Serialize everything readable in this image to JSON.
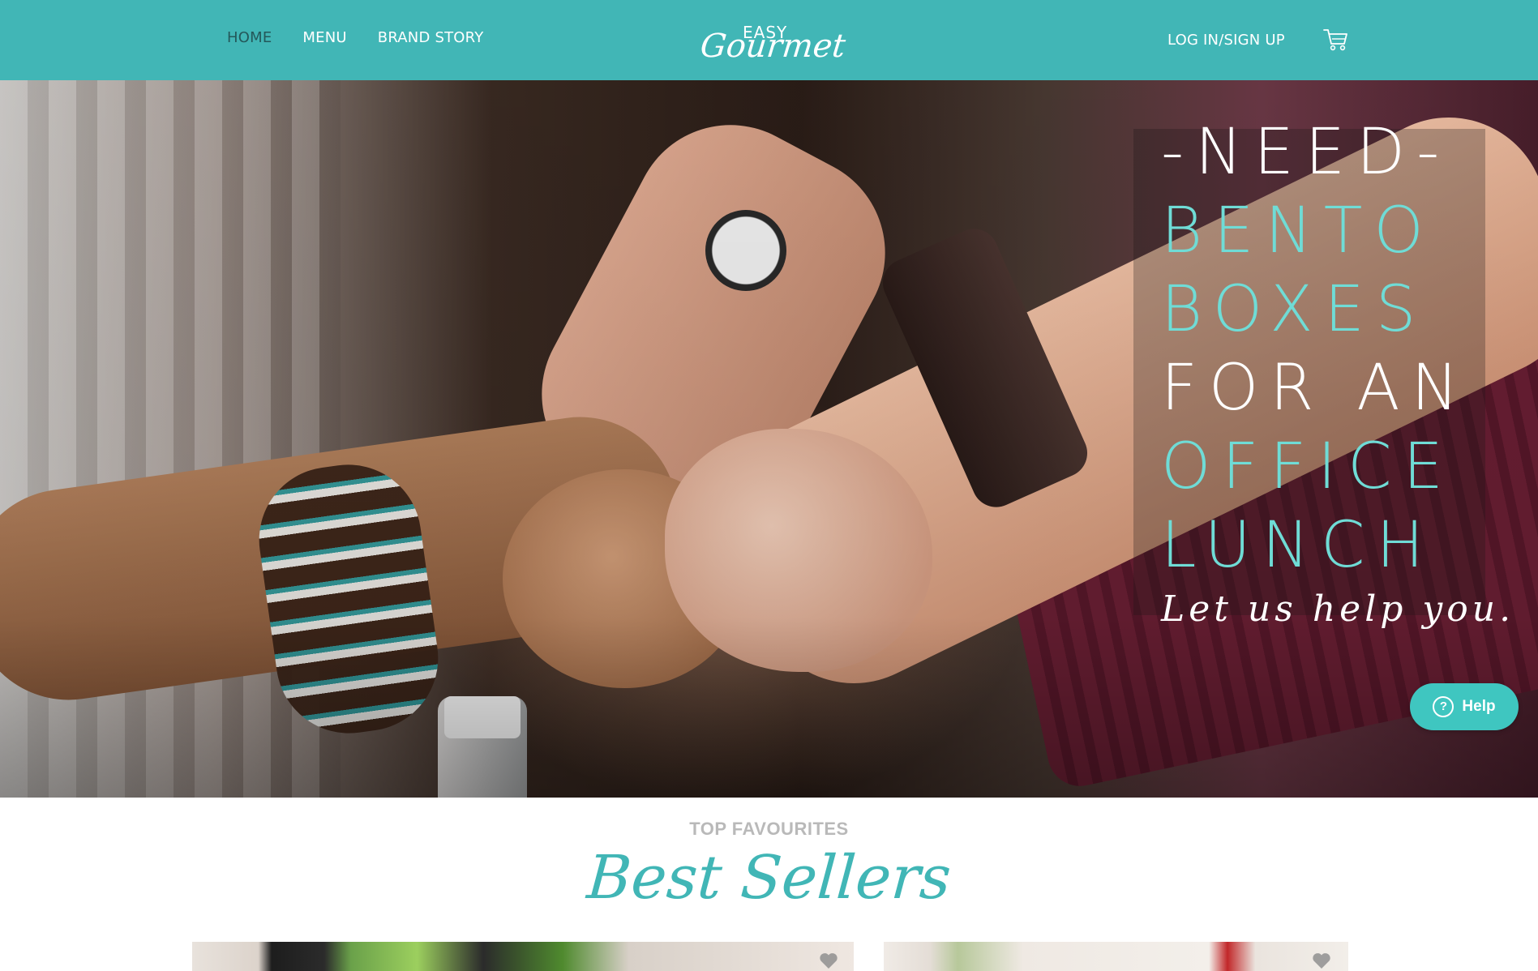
{
  "header": {
    "nav": [
      {
        "label": "HOME",
        "active": true
      },
      {
        "label": "MENU",
        "active": false
      },
      {
        "label": "BRAND STORY",
        "active": false
      }
    ],
    "logo": {
      "top": "EASY",
      "main": "Gourmet"
    },
    "login_label": "LOG IN/SIGN UP",
    "cart_icon": "shopping-cart-icon"
  },
  "hero": {
    "lines": [
      {
        "text": "-NEED-",
        "color": "white"
      },
      {
        "text": "BENTO",
        "color": "teal"
      },
      {
        "text": "BOXES",
        "color": "teal"
      },
      {
        "text": "FOR AN",
        "color": "white"
      },
      {
        "text": "OFFICE",
        "color": "teal"
      },
      {
        "text": "LUNCH",
        "color": "teal"
      }
    ],
    "tagline": "Let us help you."
  },
  "help_widget": {
    "label": "Help",
    "icon": "question-circle-icon"
  },
  "best_sellers": {
    "kicker": "TOP FAVOURITES",
    "title": "Best Sellers",
    "cards": [
      {
        "favorite_icon": "heart-icon"
      },
      {
        "favorite_icon": "heart-icon"
      }
    ]
  },
  "colors": {
    "brand_teal": "#41b6b6",
    "accent_teal": "#6fdcd6",
    "help_teal": "#3fc6c0",
    "active_nav": "#24585a",
    "kicker_gray": "#b9b9b9"
  }
}
